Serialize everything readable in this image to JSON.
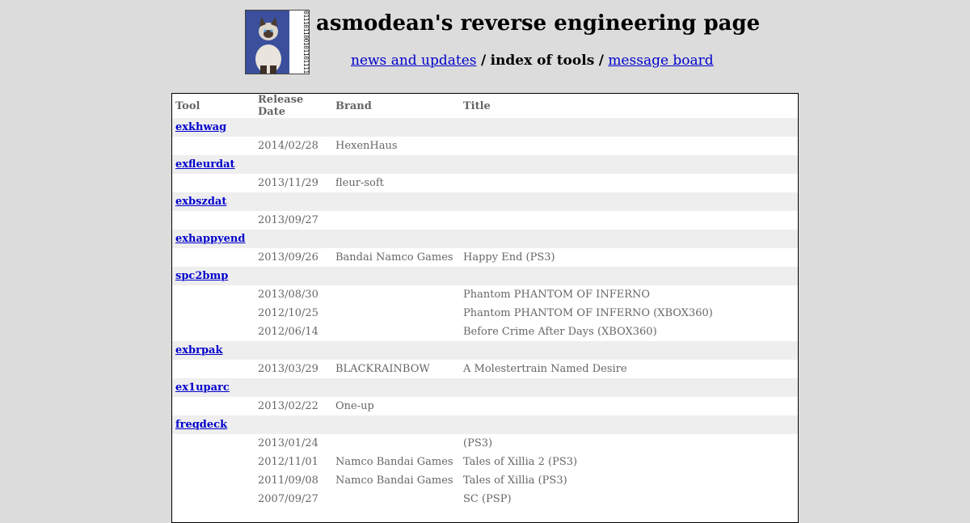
{
  "site_title": "asmodean's reverse engineering page",
  "logo": {
    "binary_text": "0111011001011011110101010010"
  },
  "nav": {
    "news": "news and updates",
    "separator": "/",
    "current": "index of tools",
    "board": "message board"
  },
  "table": {
    "headers": [
      "Tool",
      "Release Date",
      "Brand",
      "Title"
    ],
    "tools": [
      {
        "name": "exkhwag",
        "releases": [
          {
            "date": "2014/02/28",
            "brand": "HexenHaus",
            "title": ""
          }
        ]
      },
      {
        "name": "exfleurdat",
        "releases": [
          {
            "date": "2013/11/29",
            "brand": "fleur-soft",
            "title": ""
          }
        ]
      },
      {
        "name": "exbszdat",
        "releases": [
          {
            "date": "2013/09/27",
            "brand": "",
            "title": ""
          }
        ]
      },
      {
        "name": "exhappyend",
        "releases": [
          {
            "date": "2013/09/26",
            "brand": "Bandai Namco Games",
            "title": " Happy End (PS3)"
          }
        ]
      },
      {
        "name": "spc2bmp",
        "releases": [
          {
            "date": "2013/08/30",
            "brand": "",
            "title": "Phantom PHANTOM OF INFERNO"
          },
          {
            "date": "2012/10/25",
            "brand": "",
            "title": "Phantom PHANTOM OF INFERNO (XBOX360)"
          },
          {
            "date": "2012/06/14",
            "brand": "",
            "title": " Before Crime After Days (XBOX360)"
          }
        ]
      },
      {
        "name": "exbrpak",
        "releases": [
          {
            "date": "2013/03/29",
            "brand": "BLACKRAINBOW",
            "title": " A Molestertrain Named Desire"
          }
        ]
      },
      {
        "name": "ex1uparc",
        "releases": [
          {
            "date": "2013/02/22",
            "brand": "One-up",
            "title": ""
          }
        ]
      },
      {
        "name": "freqdeck",
        "releases": [
          {
            "date": "2013/01/24",
            "brand": "",
            "title": " (PS3)"
          },
          {
            "date": "2012/11/01",
            "brand": "Namco Bandai Games",
            "title": "Tales of Xillia 2 (PS3)"
          },
          {
            "date": "2011/09/08",
            "brand": "Namco Bandai Games",
            "title": "Tales of Xillia (PS3)"
          },
          {
            "date": "2007/09/27",
            "brand": "",
            "title": " SC (PSP)"
          }
        ]
      }
    ]
  }
}
